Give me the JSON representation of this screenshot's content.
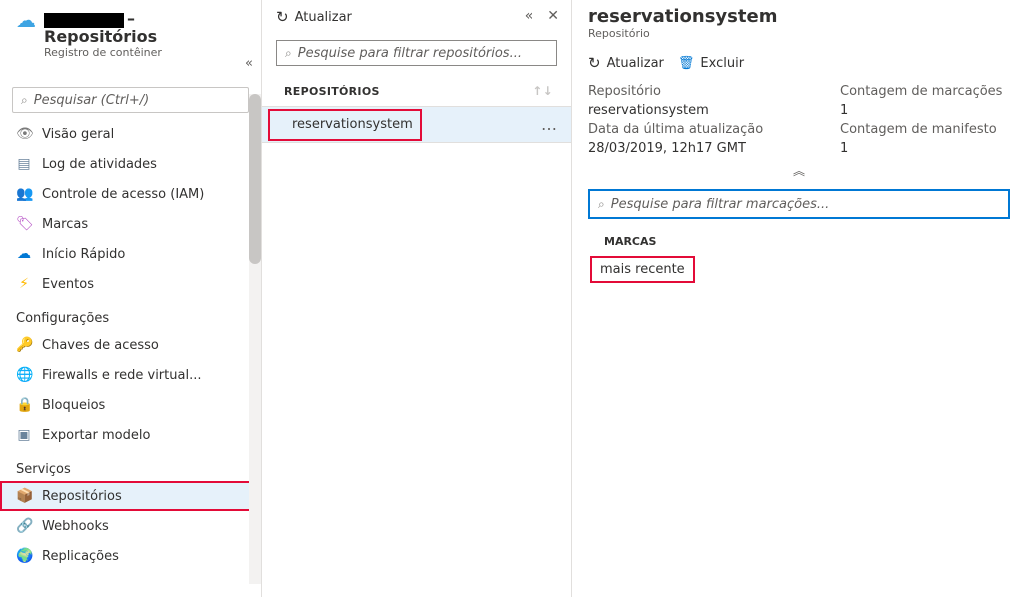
{
  "sidebar": {
    "title_suffix": "– Repositórios",
    "subtitle": "Registro de contêiner",
    "search_placeholder": "Pesquisar (Ctrl+/)",
    "general": [
      {
        "label": "Visão geral",
        "icon": "👁"
      },
      {
        "label": "Log de atividades",
        "icon": "▤"
      },
      {
        "label": "Controle de acesso (IAM)",
        "icon": "👥"
      },
      {
        "label": "Marcas",
        "icon": "🏷"
      },
      {
        "label": "Início Rápido",
        "icon": "☁"
      },
      {
        "label": "Eventos",
        "icon": "⚡"
      }
    ],
    "groups": [
      {
        "title": "Configurações",
        "items": [
          {
            "label": "Chaves de acesso",
            "icon": "🔑"
          },
          {
            "label": "Firewalls e rede virtual...",
            "icon": "🌐"
          },
          {
            "label": "Bloqueios",
            "icon": "🔒"
          },
          {
            "label": "Exportar modelo",
            "icon": "▣"
          }
        ]
      },
      {
        "title": "Serviços",
        "items": [
          {
            "label": "Repositórios",
            "icon": "📦",
            "selected": true
          },
          {
            "label": "Webhooks",
            "icon": "🔗"
          },
          {
            "label": "Replicações",
            "icon": "🌍"
          }
        ]
      }
    ]
  },
  "mid": {
    "refresh_label": "Atualizar",
    "search_placeholder": "Pesquise para filtrar repositórios...",
    "col_header": "REPOSITÓRIOS",
    "rows": [
      {
        "name": "reservationsystem"
      }
    ]
  },
  "detail": {
    "title": "reservationsystem",
    "subtitle": "Repositório",
    "refresh_label": "Atualizar",
    "delete_label": "Excluir",
    "fields": {
      "repo_label": "Repositório",
      "repo_value": "reservationsystem",
      "tagcount_label": "Contagem de marcações",
      "tagcount_value": "1",
      "updated_label": "Data da última atualização",
      "updated_value": "28/03/2019, 12h17 GMT",
      "manifest_label": "Contagem de manifesto",
      "manifest_value": "1"
    },
    "tag_search_placeholder": "Pesquise para filtrar marcações...",
    "tag_col_header": "MARCAS",
    "tags": [
      {
        "name": "mais recente"
      }
    ]
  }
}
